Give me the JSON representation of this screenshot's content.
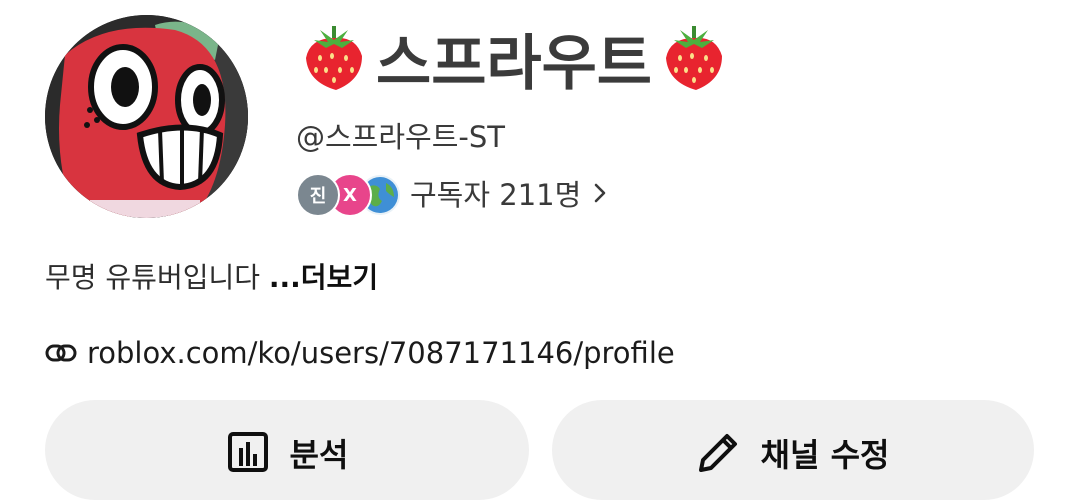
{
  "profile": {
    "channel_name": "스프라우트",
    "name_emoji": "strawberry-emoji",
    "handle": "@스프라우트-ST",
    "subscriber_avatars": [
      "진",
      "X",
      ""
    ],
    "subscribers_text": "구독자 211명"
  },
  "description": {
    "text": "무명 유튜버입니다 ",
    "more_label": "...더보기"
  },
  "link": {
    "icon": "link-icon",
    "url": "roblox.com/ko/users/7087171146/profile"
  },
  "buttons": {
    "analytics_label": "분석",
    "customize_label": "채널 수정"
  },
  "colors": {
    "button_bg": "#f0f0f0",
    "name_text": "#3b3b3b",
    "avatar_pink": "#e8458b",
    "avatar_gray": "#7b8790"
  }
}
